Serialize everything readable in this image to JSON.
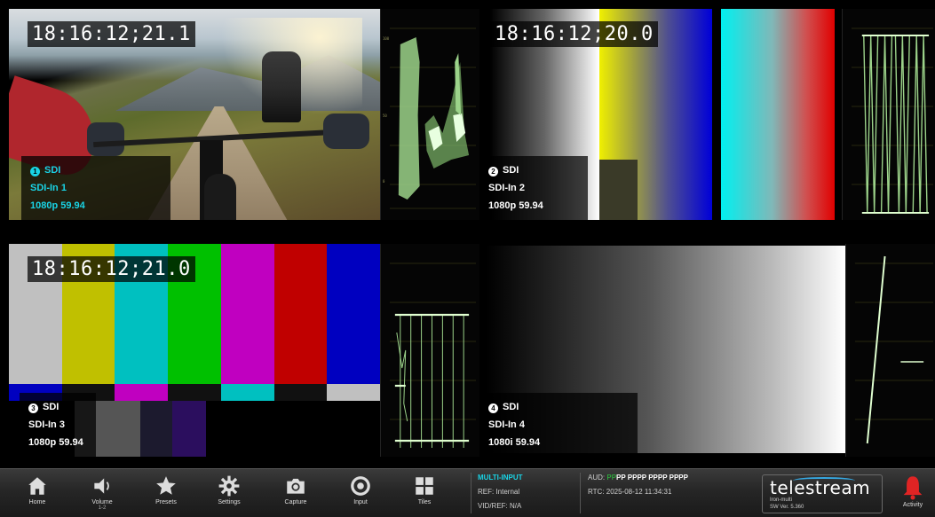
{
  "tiles": [
    {
      "timecode": "18:16:12;21.1",
      "number": "1",
      "input": "SDI",
      "name": "SDI-In 1",
      "format": "1080p 59.94"
    },
    {
      "timecode": "18:16:12;20.0",
      "number": "2",
      "input": "SDI",
      "name": "SDI-In 2",
      "format": "1080p 59.94"
    },
    {
      "timecode": "18:16:12;21.0",
      "number": "3",
      "input": "SDI",
      "name": "SDI-In 3",
      "format": "1080p 59.94"
    },
    {
      "timecode": "",
      "number": "4",
      "input": "SDI",
      "name": "SDI-In 4",
      "format": "1080i 59.94"
    }
  ],
  "scope_scale": [
    "940",
    "700",
    "500",
    "300",
    "64"
  ],
  "colors": {
    "accent_cyan": "#19d4e6",
    "trace_green": "#8bd06a",
    "brand_blue": "#36a7e0",
    "activity_red": "#e02424"
  },
  "taskbar": {
    "buttons": [
      {
        "label": "Home",
        "icon": "home-icon"
      },
      {
        "label": "Volume",
        "sub": "1-2",
        "icon": "speaker-icon"
      },
      {
        "label": "Presets",
        "icon": "star-icon"
      },
      {
        "label": "Settings",
        "icon": "gear-icon"
      },
      {
        "label": "Capture",
        "icon": "camera-icon"
      },
      {
        "label": "Input",
        "icon": "input-icon"
      },
      {
        "label": "Tiles",
        "icon": "tiles-icon"
      }
    ],
    "mode": "MULTI-INPUT",
    "ref": "REF: Internal",
    "vidref": "VID/REF: N/A",
    "aud_label": "AUD:",
    "aud_green": "PP",
    "aud_rest": "PP PPPP PPPP PPPP",
    "rtc": "RTC: 2025-08-12 11:34:31",
    "brand": "telestream",
    "product": "Iron-multi",
    "sw_version": "SW Ver. 5.360",
    "activity": "Activity"
  }
}
